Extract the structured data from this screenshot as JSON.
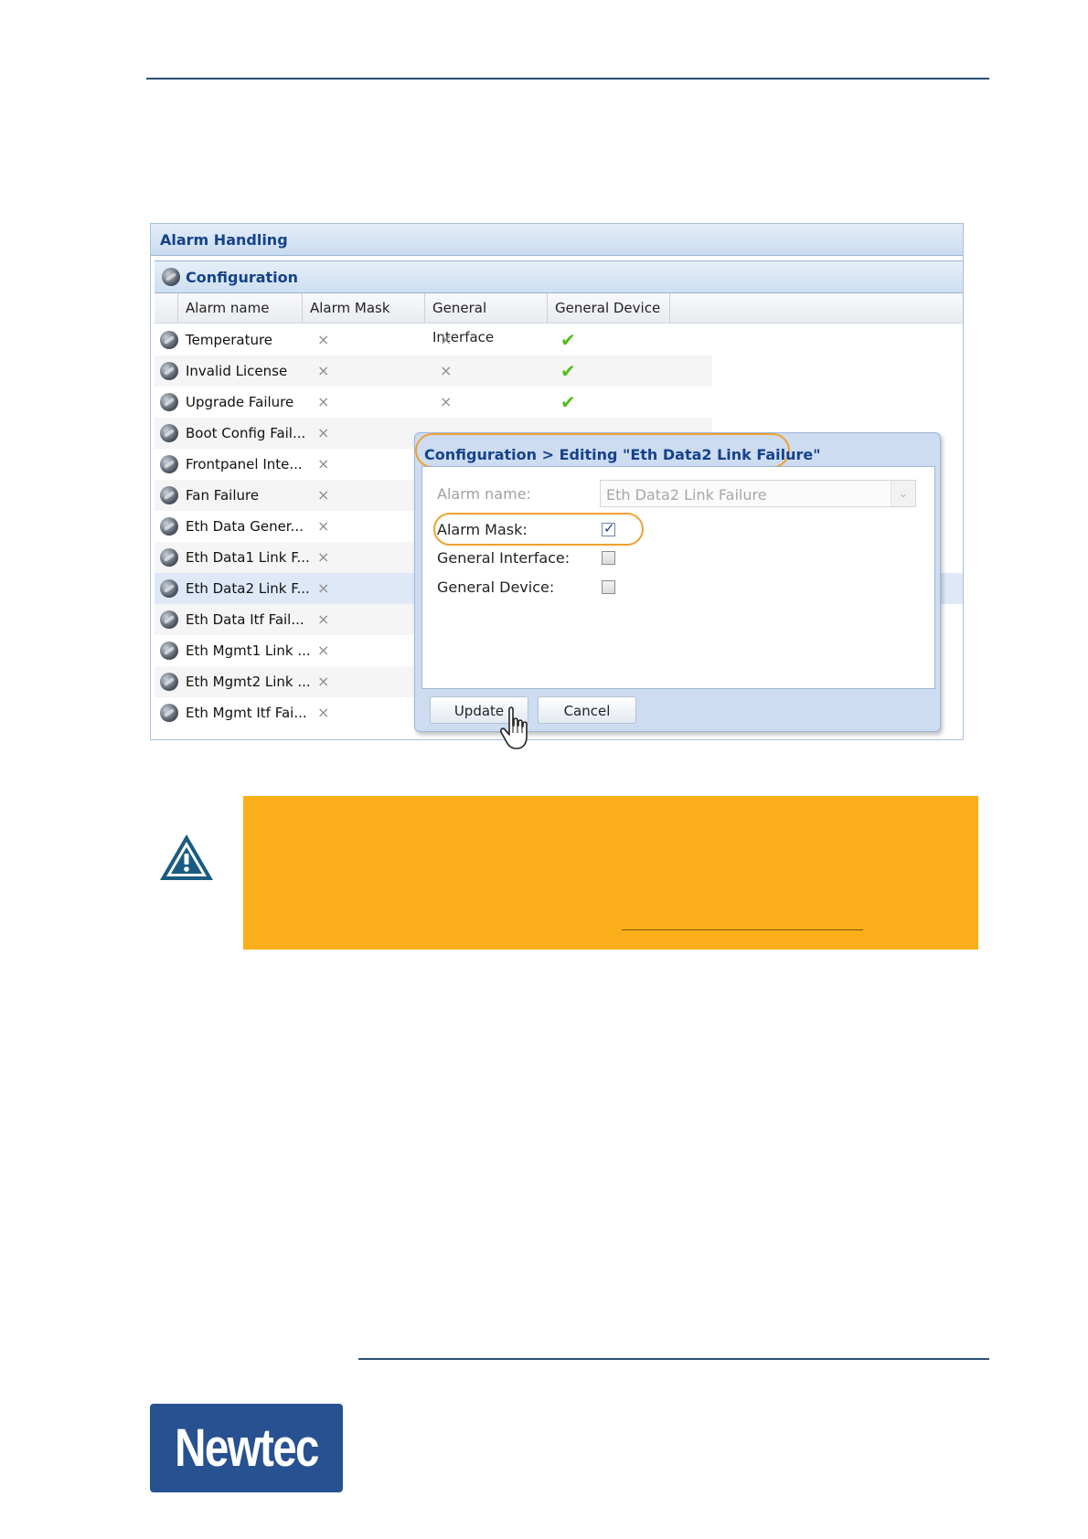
{
  "screenshot": {
    "panel_title": "Alarm Handling",
    "subpanel_title": "Configuration",
    "columns": [
      "Alarm name",
      "Alarm Mask",
      "General Interface",
      "General Device"
    ],
    "rows": [
      {
        "name": "Temperature",
        "mask": "×",
        "iface": "×",
        "device": "✔"
      },
      {
        "name": "Invalid License",
        "mask": "×",
        "iface": "×",
        "device": "✔"
      },
      {
        "name": "Upgrade Failure",
        "mask": "×",
        "iface": "×",
        "device": "✔"
      },
      {
        "name": "Boot Config Fail...",
        "mask": "×"
      },
      {
        "name": "Frontpanel Inte...",
        "mask": "×"
      },
      {
        "name": "Fan Failure",
        "mask": "×"
      },
      {
        "name": "Eth Data Gener...",
        "mask": "×"
      },
      {
        "name": "Eth Data1 Link F...",
        "mask": "×"
      },
      {
        "name": "Eth Data2 Link F...",
        "mask": "×",
        "selected": true
      },
      {
        "name": "Eth Data Itf Fail...",
        "mask": "×"
      },
      {
        "name": "Eth Mgmt1 Link ...",
        "mask": "×"
      },
      {
        "name": "Eth Mgmt2 Link ...",
        "mask": "×"
      },
      {
        "name": "Eth Mgmt Itf Fai...",
        "mask": "×"
      }
    ],
    "dialog": {
      "title": "Configuration > Editing \"Eth Data2 Link Failure\"",
      "alarm_name_label": "Alarm name:",
      "alarm_name_value": "Eth Data2 Link Failure",
      "alarm_mask_label": "Alarm Mask:",
      "general_interface_label": "General Interface:",
      "general_device_label": "General Device:",
      "alarm_mask_checked": true,
      "general_interface_checked": false,
      "general_device_checked": false,
      "update_label": "Update",
      "cancel_label": "Cancel"
    }
  },
  "colors": {
    "rule": "#2a4f74",
    "warning_box": "#f9ae1a",
    "highlight": "#f0a030",
    "logo": "#275191"
  },
  "logo": {
    "text": "Newtec"
  }
}
